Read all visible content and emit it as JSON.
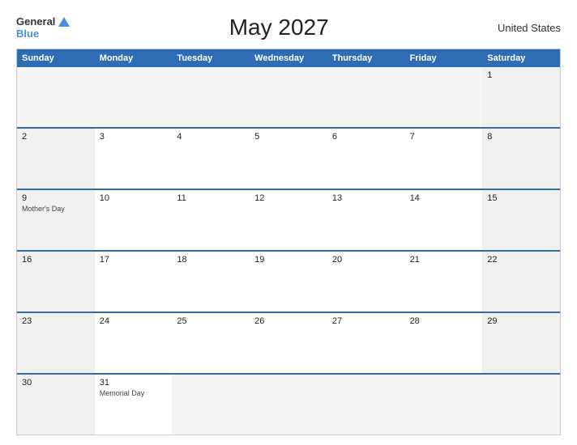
{
  "header": {
    "logo_general": "General",
    "logo_blue": "Blue",
    "title": "May 2027",
    "country": "United States"
  },
  "day_headers": [
    "Sunday",
    "Monday",
    "Tuesday",
    "Wednesday",
    "Thursday",
    "Friday",
    "Saturday"
  ],
  "weeks": [
    [
      {
        "num": "",
        "holiday": "",
        "empty": true
      },
      {
        "num": "",
        "holiday": "",
        "empty": true
      },
      {
        "num": "",
        "holiday": "",
        "empty": true
      },
      {
        "num": "",
        "holiday": "",
        "empty": true
      },
      {
        "num": "",
        "holiday": "",
        "empty": true
      },
      {
        "num": "",
        "holiday": "",
        "empty": true
      },
      {
        "num": "1",
        "holiday": ""
      }
    ],
    [
      {
        "num": "2",
        "holiday": ""
      },
      {
        "num": "3",
        "holiday": ""
      },
      {
        "num": "4",
        "holiday": ""
      },
      {
        "num": "5",
        "holiday": ""
      },
      {
        "num": "6",
        "holiday": ""
      },
      {
        "num": "7",
        "holiday": ""
      },
      {
        "num": "8",
        "holiday": ""
      }
    ],
    [
      {
        "num": "9",
        "holiday": "Mother's Day"
      },
      {
        "num": "10",
        "holiday": ""
      },
      {
        "num": "11",
        "holiday": ""
      },
      {
        "num": "12",
        "holiday": ""
      },
      {
        "num": "13",
        "holiday": ""
      },
      {
        "num": "14",
        "holiday": ""
      },
      {
        "num": "15",
        "holiday": ""
      }
    ],
    [
      {
        "num": "16",
        "holiday": ""
      },
      {
        "num": "17",
        "holiday": ""
      },
      {
        "num": "18",
        "holiday": ""
      },
      {
        "num": "19",
        "holiday": ""
      },
      {
        "num": "20",
        "holiday": ""
      },
      {
        "num": "21",
        "holiday": ""
      },
      {
        "num": "22",
        "holiday": ""
      }
    ],
    [
      {
        "num": "23",
        "holiday": ""
      },
      {
        "num": "24",
        "holiday": ""
      },
      {
        "num": "25",
        "holiday": ""
      },
      {
        "num": "26",
        "holiday": ""
      },
      {
        "num": "27",
        "holiday": ""
      },
      {
        "num": "28",
        "holiday": ""
      },
      {
        "num": "29",
        "holiday": ""
      }
    ],
    [
      {
        "num": "30",
        "holiday": ""
      },
      {
        "num": "31",
        "holiday": "Memorial Day"
      },
      {
        "num": "",
        "holiday": "",
        "empty": true
      },
      {
        "num": "",
        "holiday": "",
        "empty": true
      },
      {
        "num": "",
        "holiday": "",
        "empty": true
      },
      {
        "num": "",
        "holiday": "",
        "empty": true
      },
      {
        "num": "",
        "holiday": "",
        "empty": true
      }
    ]
  ],
  "col_classes": [
    "col-sun",
    "col-mon",
    "col-tue",
    "col-wed",
    "col-thu",
    "col-fri",
    "col-sat"
  ]
}
